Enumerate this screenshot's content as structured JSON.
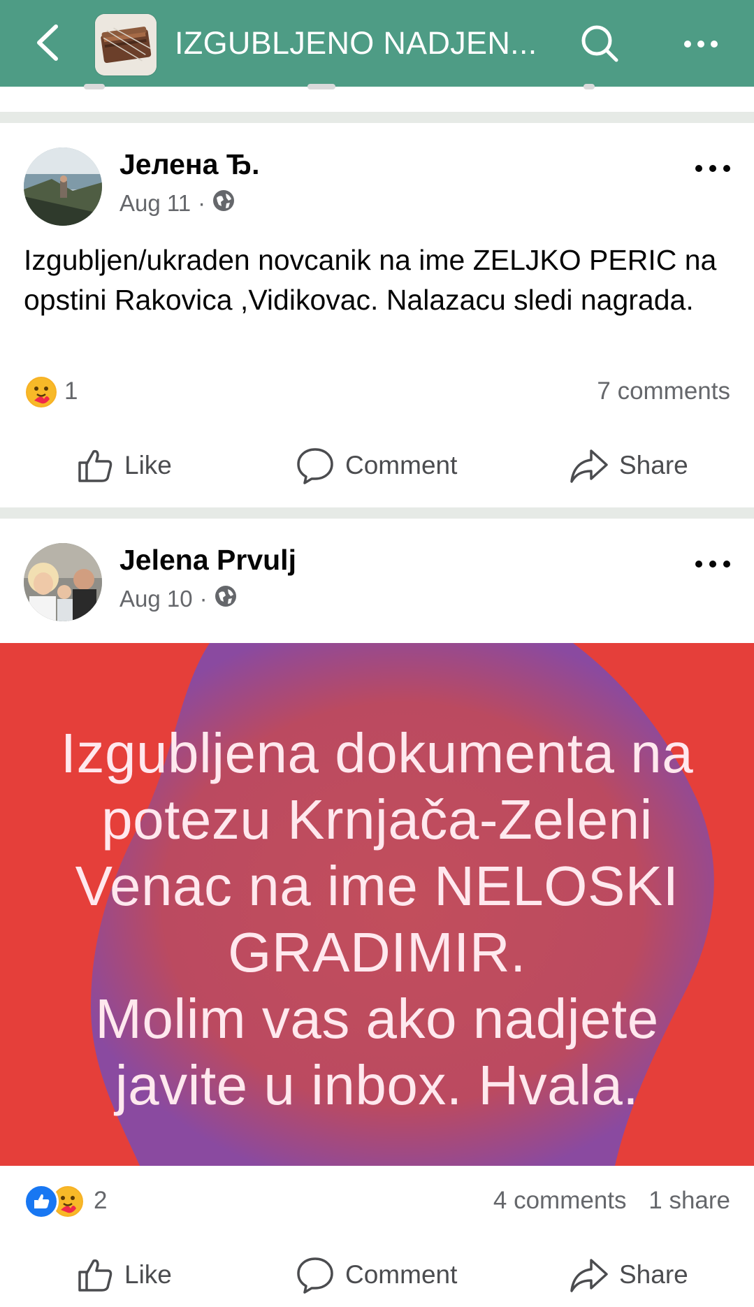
{
  "header": {
    "title": "IZGUBLJENO NADJEN...",
    "back_icon": "chevron-left-icon",
    "search_icon": "search-icon",
    "more_icon": "more-dots-icon",
    "color": "#4e9c85"
  },
  "posts": [
    {
      "author": "Јелена Ђ.",
      "date": "Aug 11",
      "separator": "·",
      "privacy_icon": "globe-icon",
      "text": "Izgubljen/ukraden novcanik na ime ZELJKO PERIC na opstini Rakovica ,Vidikovac. Nalazacu sledi nagrada.",
      "reaction_count": "1",
      "comments": "7 comments",
      "actions": {
        "like": "Like",
        "comment": "Comment",
        "share": "Share"
      }
    },
    {
      "author": "Jelena Prvulj",
      "date": "Aug 10",
      "separator": "·",
      "privacy_icon": "globe-icon",
      "image_text": "Izgubljena dokumenta na potezu Krnjača-Zeleni Venac na ime NELOSKI GRADIMIR.\nMolim vas ako nadjete javite u inbox. Hvala.",
      "image_bg_color": "#e53f3a",
      "reaction_count": "2",
      "comments": "4 comments",
      "shares": "1 share",
      "actions": {
        "like": "Like",
        "comment": "Comment",
        "share": "Share"
      }
    }
  ]
}
